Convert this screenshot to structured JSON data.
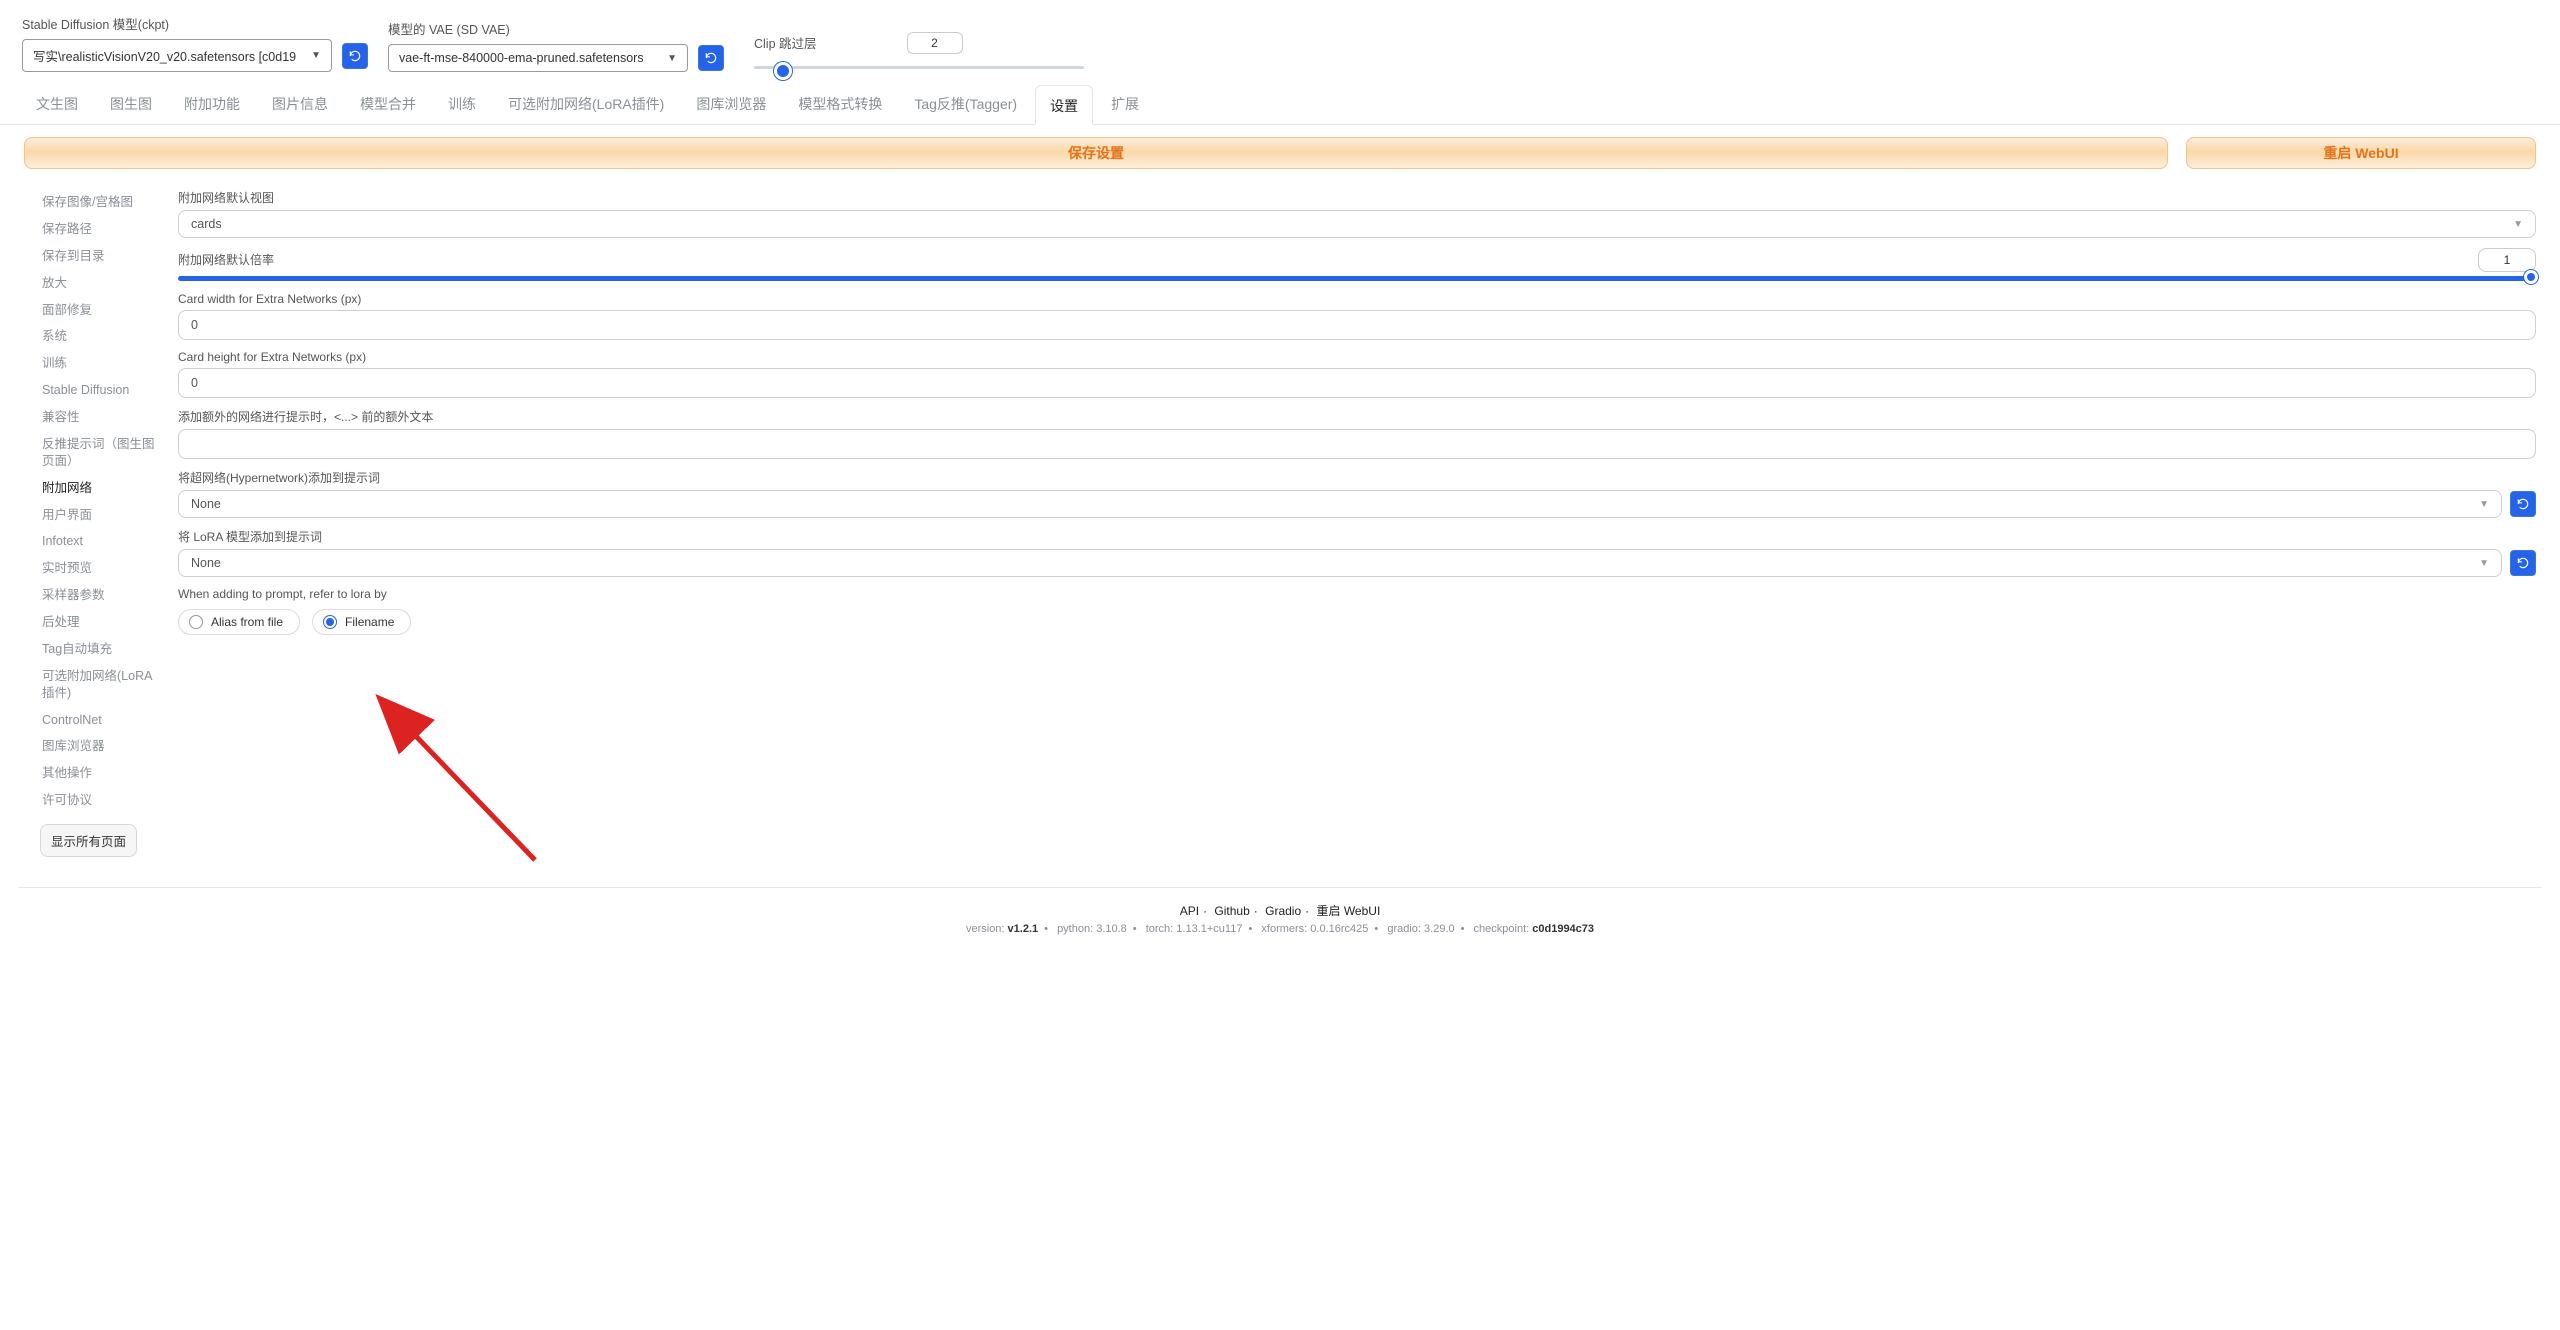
{
  "top": {
    "model_label": "Stable Diffusion 模型(ckpt)",
    "model_value": "写实\\realisticVisionV20_v20.safetensors [c0d19",
    "vae_label": "模型的 VAE (SD VAE)",
    "vae_value": "vae-ft-mse-840000-ema-pruned.safetensors",
    "clip_label": "Clip 跳过层",
    "clip_value": "2"
  },
  "tabs": [
    "文生图",
    "图生图",
    "附加功能",
    "图片信息",
    "模型合并",
    "训练",
    "可选附加网络(LoRA插件)",
    "图库浏览器",
    "模型格式转换",
    "Tag反推(Tagger)",
    "设置",
    "扩展"
  ],
  "active_tab_index": 10,
  "buttons": {
    "save": "保存设置",
    "restart": "重启 WebUI"
  },
  "sidebar": {
    "items": [
      "保存图像/宫格图",
      "保存路径",
      "保存到目录",
      "放大",
      "面部修复",
      "系统",
      "训练",
      "Stable Diffusion",
      "兼容性",
      "反推提示词（图生图页面）",
      "附加网络",
      "用户界面",
      "Infotext",
      "实时预览",
      "采样器参数",
      "后处理",
      "Tag自动填充",
      "可选附加网络(LoRA插件)",
      "ControlNet",
      "图库浏览器",
      "其他操作",
      "许可协议"
    ],
    "active_index": 10,
    "show_all": "显示所有页面"
  },
  "content": {
    "view_label": "附加网络默认视图",
    "view_value": "cards",
    "mult_label": "附加网络默认倍率",
    "mult_value": "1",
    "card_w_label": "Card width for Extra Networks (px)",
    "card_w_value": "0",
    "card_h_label": "Card height for Extra Networks (px)",
    "card_h_value": "0",
    "extra_text_label": "添加额外的网络进行提示时，<...> 前的额外文本",
    "extra_text_value": "",
    "hyper_label": "将超网络(Hypernetwork)添加到提示词",
    "hyper_value": "None",
    "lora_label": "将 LoRA 模型添加到提示词",
    "lora_value": "None",
    "refer_label": "When adding to prompt, refer to lora by",
    "radio_alias": "Alias from file",
    "radio_filename": "Filename"
  },
  "footer": {
    "api": "API",
    "github": "Github",
    "gradio": "Gradio",
    "restart": "重启 WebUI",
    "ver_prefix": "version: ",
    "version": "v1.2.1",
    "python_prefix": "python: ",
    "python": "3.10.8",
    "torch_prefix": "torch: ",
    "torch": "1.13.1+cu117",
    "xformers_prefix": "xformers: ",
    "xformers": "0.0.16rc425",
    "gradio_prefix": "gradio: ",
    "gradio_v": "3.29.0",
    "ckpt_prefix": "checkpoint: ",
    "ckpt": "c0d1994c73"
  }
}
